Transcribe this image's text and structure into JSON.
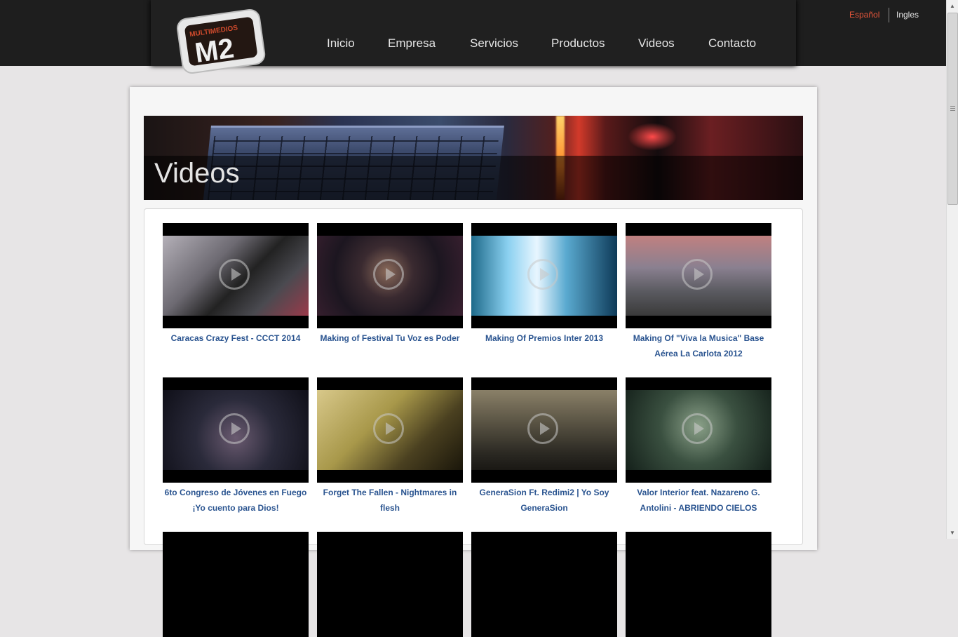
{
  "brand": {
    "logo_top": "MULTIMEDIOS",
    "logo_main": "M2"
  },
  "nav": {
    "items": [
      {
        "label": "Inicio"
      },
      {
        "label": "Empresa"
      },
      {
        "label": "Servicios"
      },
      {
        "label": "Productos"
      },
      {
        "label": "Videos"
      },
      {
        "label": "Contacto"
      }
    ]
  },
  "languages": {
    "es": "Español",
    "en": "Ingles",
    "active": "Español"
  },
  "banner": {
    "title": "Videos"
  },
  "videos": [
    {
      "title": "Caracas Crazy Fest - CCCT 2014"
    },
    {
      "title": "Making of Festival Tu Voz es Poder"
    },
    {
      "title": "Making Of Premios Inter 2013"
    },
    {
      "title": "Making Of \"Viva la Musica\" Base Aérea La Carlota 2012"
    },
    {
      "title": "6to Congreso de Jóvenes en Fuego ¡Yo cuento para Dios!"
    },
    {
      "title": "Forget The Fallen - Nightmares in flesh"
    },
    {
      "title": "GeneraSion Ft. Redimi2 | Yo Soy GeneraSion"
    },
    {
      "title": "Valor Interior feat. Nazareno G. Antolini - ABRIENDO CIELOS"
    }
  ],
  "colors": {
    "header_bg": "#1e1e1e",
    "active_lang": "#e2553a",
    "link": "#2a5490",
    "page_bg": "#e7e5e6"
  }
}
